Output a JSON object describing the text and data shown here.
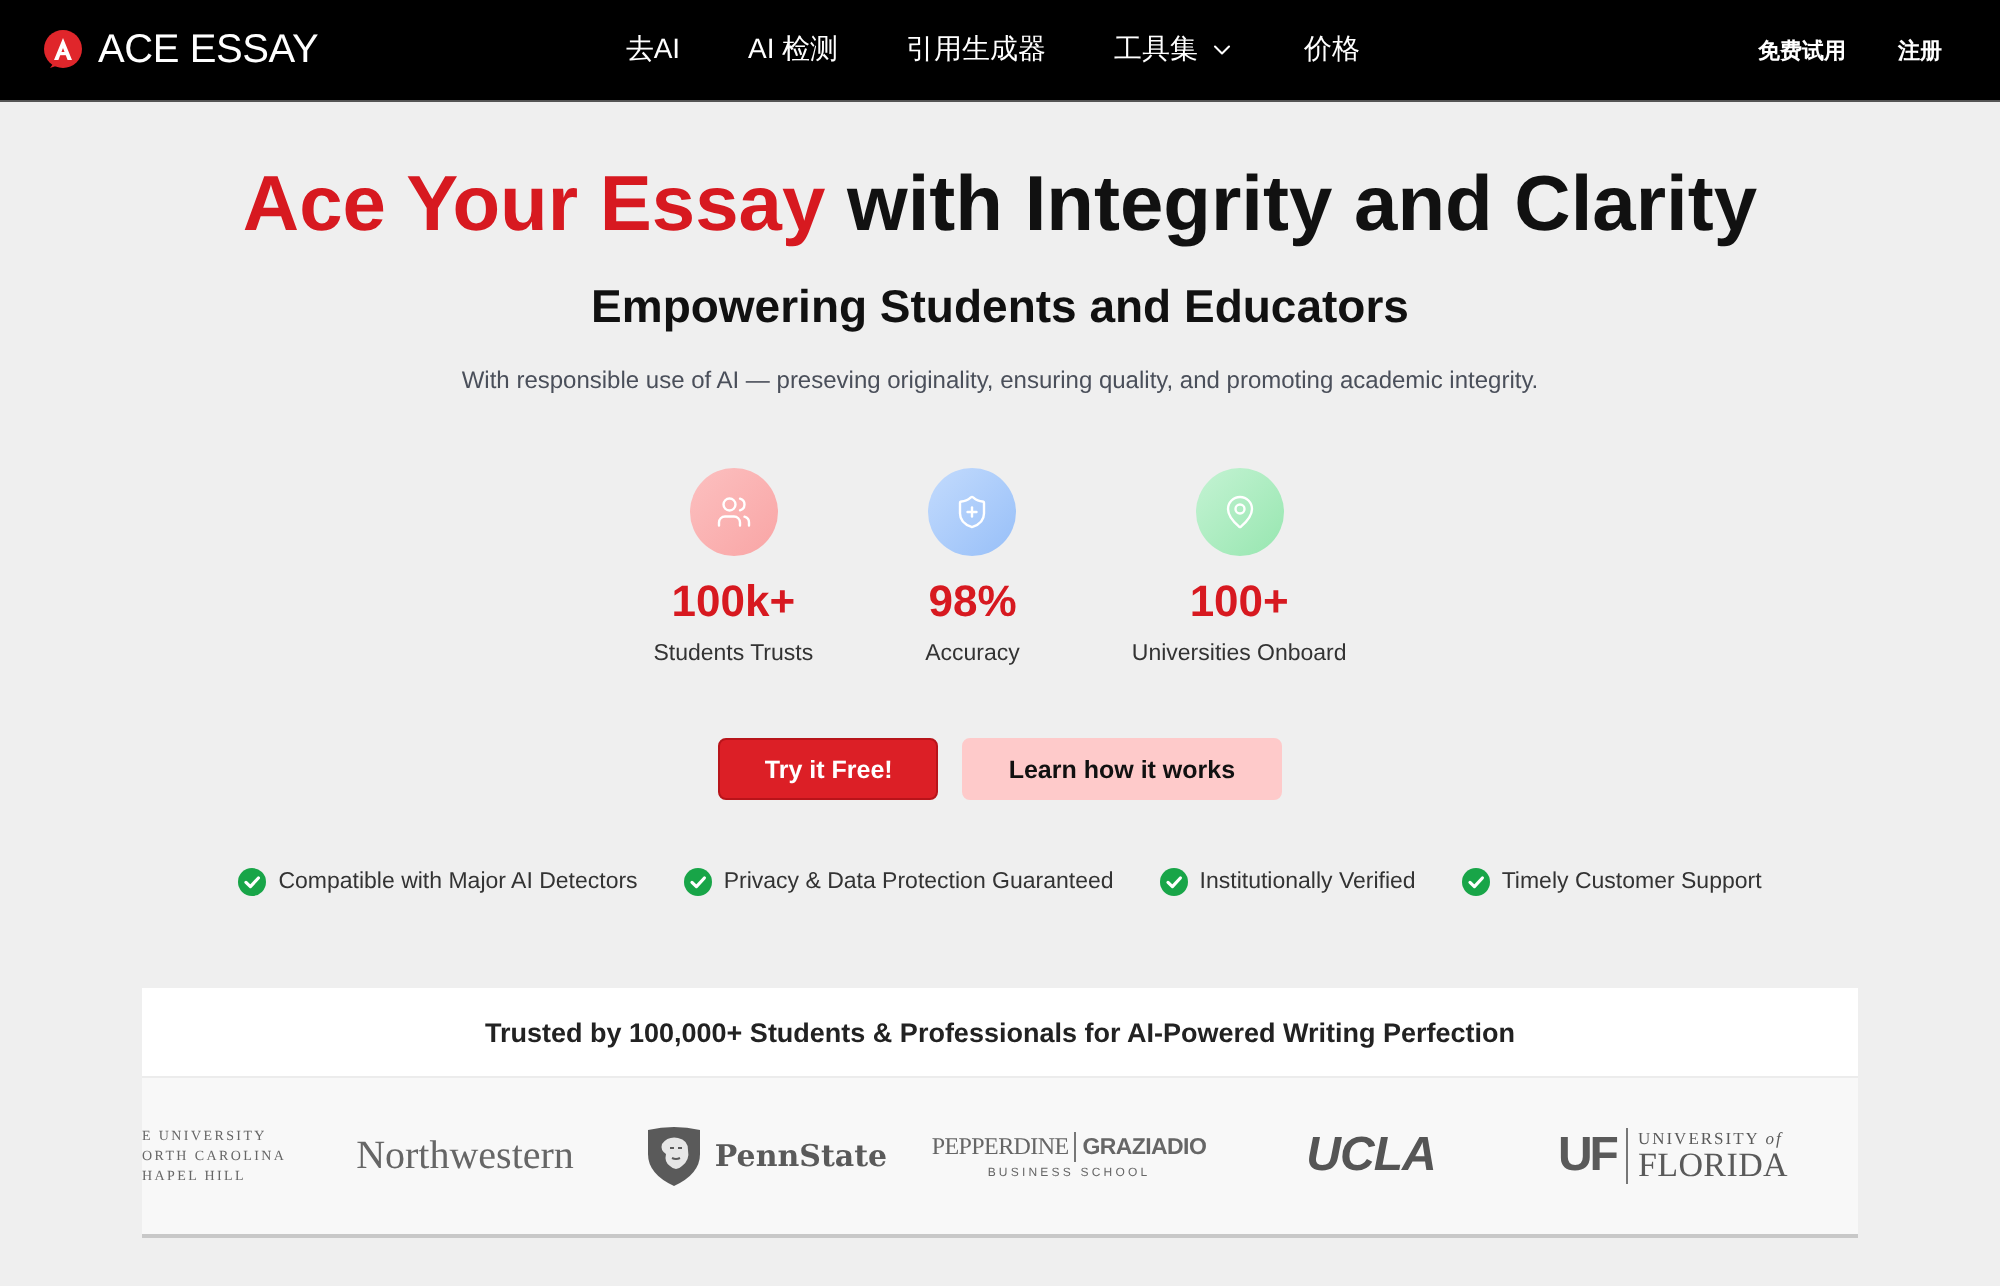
{
  "header": {
    "brand": "ACE ESSAY",
    "nav": [
      {
        "label": "去AI",
        "kind": "link"
      },
      {
        "label": "AI 检测",
        "kind": "link"
      },
      {
        "label": "引用生成器",
        "kind": "link"
      },
      {
        "label": "工具集",
        "kind": "menu"
      },
      {
        "label": "价格",
        "kind": "link"
      }
    ],
    "actions": [
      "免费试用",
      "注册"
    ]
  },
  "hero": {
    "title": {
      "accent": "Ace Your Essay",
      "rest": "with Integrity and Clarity"
    },
    "subtitle": "Empowering Students and Educators",
    "tagline": "With responsible use of AI — preseving originality, ensuring quality, and promoting academic integrity."
  },
  "stats": [
    {
      "kind": "users",
      "value": "100k+",
      "label": "Students Trusts"
    },
    {
      "kind": "shield",
      "value": "98%",
      "label": "Accuracy"
    },
    {
      "kind": "pin",
      "value": "100+",
      "label": "Universities Onboard"
    }
  ],
  "buttons": [
    {
      "kind": "primary",
      "label": "Try it Free!"
    },
    {
      "kind": "secondary",
      "label": "Learn how it works"
    }
  ],
  "features": [
    "Compatible with Major AI Detectors",
    "Privacy & Data Protection Guaranteed",
    "Institutionally Verified",
    "Timely Customer Support"
  ],
  "trusted": {
    "title": "Trusted by 100,000+ Students & Professionals for AI-Powered Writing Perfection",
    "logos": [
      {
        "kind": "stacked",
        "lines": [
          "E UNIVERSITY",
          "ORTH CAROLINA",
          "HAPEL HILL"
        ]
      },
      {
        "kind": "serif",
        "text": "Northwestern"
      },
      {
        "kind": "shield",
        "text": "PennState"
      },
      {
        "kind": "split",
        "left": "PEPPERDINE",
        "right": "GRAZIADIO",
        "sub": "BUSINESS SCHOOL"
      },
      {
        "kind": "bold",
        "text": "UCLA"
      },
      {
        "kind": "monogram",
        "mark": "UF",
        "top": "UNIVERSITY *of*",
        "bottom": "FLORIDA"
      }
    ]
  }
}
